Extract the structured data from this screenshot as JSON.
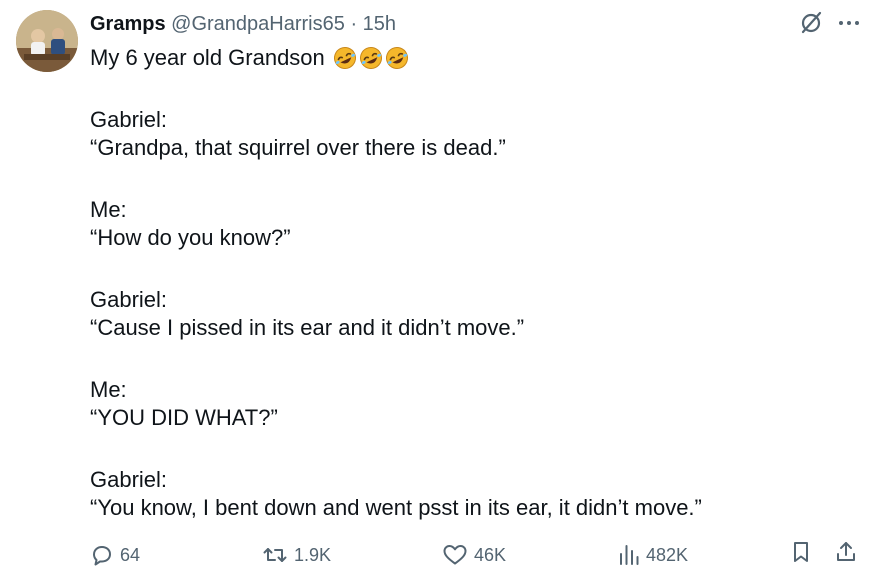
{
  "author": {
    "name": "Gramps",
    "handle": "@GrandpaHarris65",
    "separator": "·",
    "time": "15h"
  },
  "icons": {
    "grok": "grok-icon",
    "more": "more-icon",
    "emoji": "rolling-on-floor-laughing-emoji"
  },
  "tweet": {
    "intro": "My 6 year old Grandson",
    "lines": {
      "l1": "Gabriel:",
      "l2": "“Grandpa, that squirrel over there is dead.”",
      "l3": "Me:",
      "l4": "“How do you know?”",
      "l5": "Gabriel:",
      "l6": "“Cause I pissed in its ear and it didn’t move.”",
      "l7": "Me:",
      "l8": "“YOU DID WHAT?”",
      "l9": "Gabriel:",
      "l10": "“You know, I bent down and went psst in its ear, it didn’t move.”"
    }
  },
  "metrics": {
    "replies": "64",
    "reposts": "1.9K",
    "likes": "46K",
    "views": "482K"
  },
  "colors": {
    "text": "#0f1419",
    "secondary": "#536471",
    "emoji_yellow": "#f5b72b"
  }
}
